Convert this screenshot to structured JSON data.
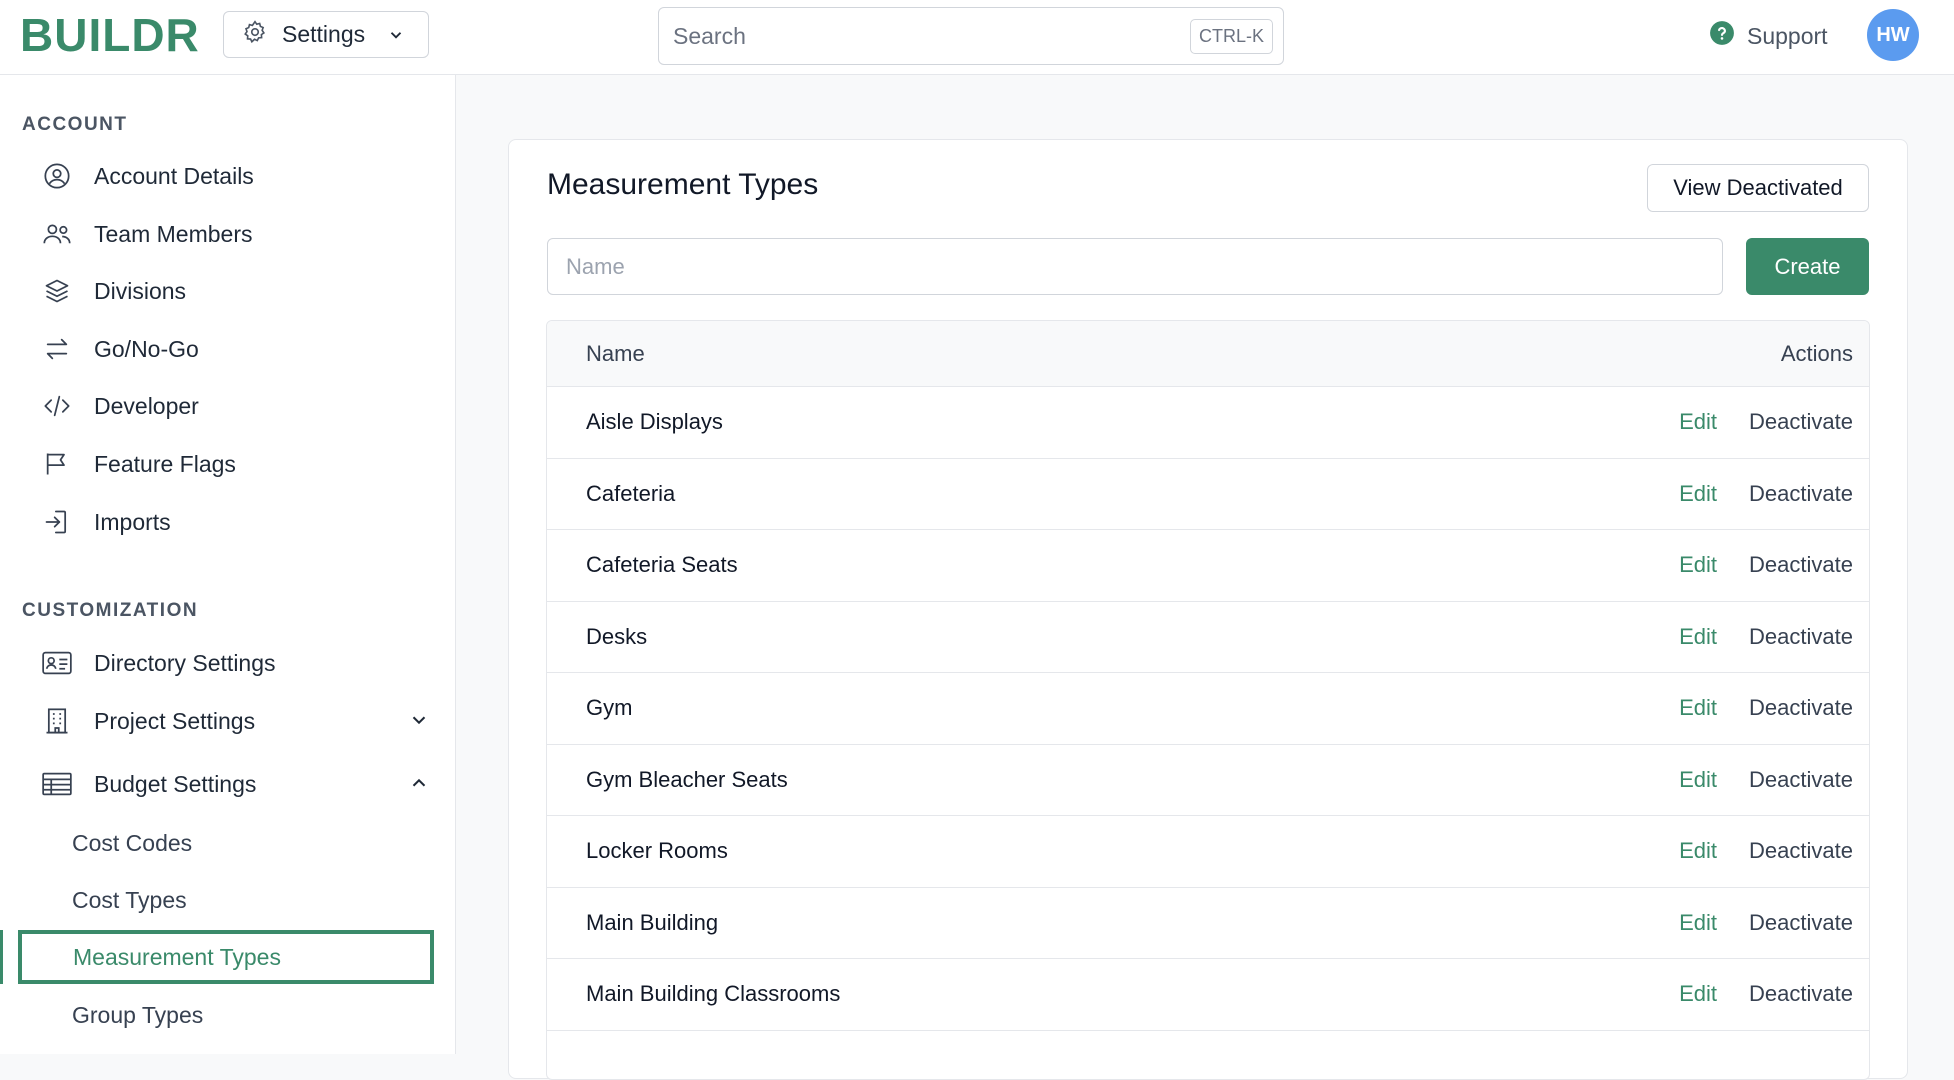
{
  "app": {
    "logo": "BUILDR"
  },
  "header": {
    "settings_label": "Settings",
    "search_placeholder": "Search",
    "search_shortcut": "CTRL-K",
    "support_label": "Support",
    "avatar_initials": "HW"
  },
  "sidebar": {
    "account_title": "ACCOUNT",
    "account_items": [
      {
        "label": "Account Details",
        "icon": "user-circle-icon"
      },
      {
        "label": "Team Members",
        "icon": "users-icon"
      },
      {
        "label": "Divisions",
        "icon": "layers-icon"
      },
      {
        "label": "Go/No-Go",
        "icon": "arrows-exchange-icon"
      },
      {
        "label": "Developer",
        "icon": "code-icon"
      },
      {
        "label": "Feature Flags",
        "icon": "flag-icon"
      },
      {
        "label": "Imports",
        "icon": "import-icon"
      }
    ],
    "customization_title": "CUSTOMIZATION",
    "customization_items": [
      {
        "label": "Directory Settings",
        "icon": "id-card-icon"
      },
      {
        "label": "Project Settings",
        "icon": "building-icon"
      },
      {
        "label": "Budget Settings",
        "icon": "table-icon"
      }
    ],
    "budget_sub_items": [
      "Cost Codes",
      "Cost Types",
      "Measurement Types",
      "Group Types"
    ]
  },
  "main": {
    "title": "Measurement Types",
    "view_deactivated_label": "View Deactivated",
    "name_placeholder": "Name",
    "create_label": "Create",
    "table": {
      "columns": [
        "Name",
        "Actions"
      ],
      "edit_label": "Edit",
      "deactivate_label": "Deactivate",
      "rows": [
        "Aisle Displays",
        "Cafeteria",
        "Cafeteria Seats",
        "Desks",
        "Gym",
        "Gym Bleacher Seats",
        "Locker Rooms",
        "Main Building",
        "Main Building Classrooms"
      ]
    }
  },
  "colors": {
    "brand": "#3a8a6a",
    "avatar": "#5b9bef"
  }
}
